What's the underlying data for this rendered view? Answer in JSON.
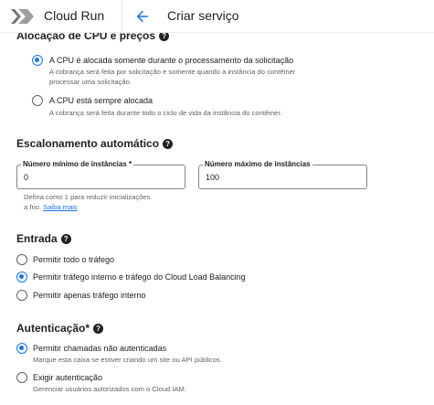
{
  "header": {
    "app_title": "Cloud Run",
    "page_title": "Criar serviço",
    "logo_icon": "cloud-run-logo-icon",
    "back_icon": "arrow-back-icon"
  },
  "cpu_section": {
    "title": "Alocação de CPU e preços",
    "options": [
      {
        "label": "A CPU é alocada somente durante o processamento da solicitação",
        "desc1": "A cobrança será feita por solicitação e somente quando a instância do contêiner",
        "desc2": "processar uma solicitação.",
        "selected": true
      },
      {
        "label": "A CPU está sempre alocada",
        "desc1": "A cobrança será feita durante todo o ciclo de vida da instância do contêiner.",
        "selected": false
      }
    ]
  },
  "autoscaling": {
    "title": "Escalonamento automático",
    "min_label": "Número mínimo de instâncias *",
    "min_value": "0",
    "max_label": "Número máximo de instâncias",
    "max_value": "100",
    "helper_line1": "Defina como 1 para reduzir inicializações",
    "helper_line2": "a frio.",
    "helper_link": "Saiba mais"
  },
  "ingress": {
    "title": "Entrada",
    "options": [
      {
        "label": "Permitir todo o tráfego",
        "selected": false
      },
      {
        "label": "Permitir tráfego interno e tráfego do Cloud Load Balancing",
        "selected": true
      },
      {
        "label": "Permitir apenas tráfego interno",
        "selected": false
      }
    ]
  },
  "auth": {
    "title": "Autenticação*",
    "options": [
      {
        "label": "Permitir chamadas não autenticadas",
        "desc": "Marque esta caixa se estiver criando um site ou API públicos.",
        "selected": true
      },
      {
        "label": "Exigir autenticação",
        "desc": "Gerenciar usuários autorizados com o Cloud IAM.",
        "selected": false
      }
    ]
  },
  "colors": {
    "accent": "#1a73e8",
    "text": "#202124",
    "secondary": "#5f6368"
  }
}
